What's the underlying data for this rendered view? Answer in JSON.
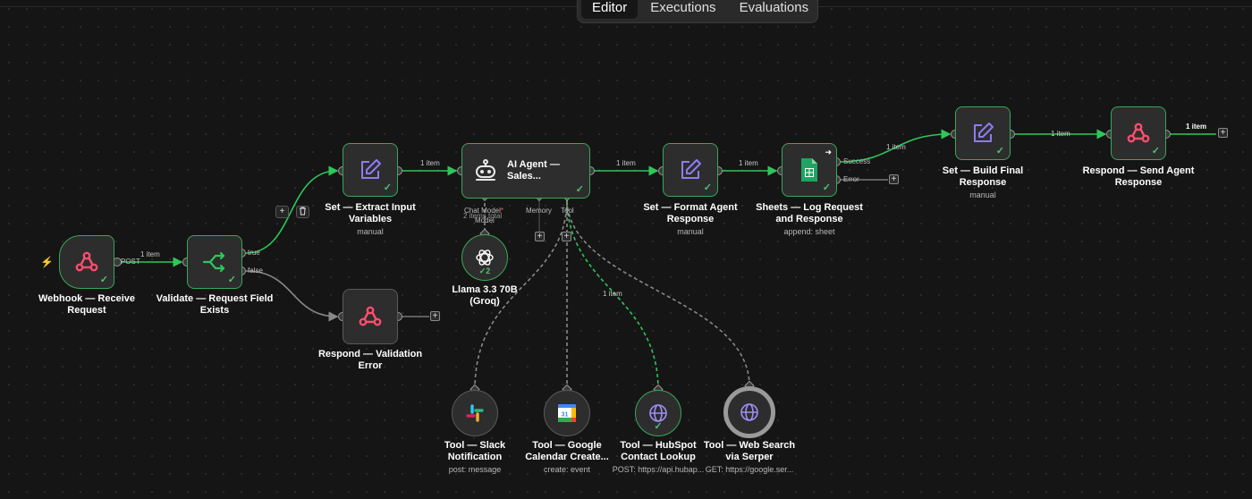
{
  "tabs": [
    {
      "label": "Editor",
      "active": true
    },
    {
      "label": "Executions",
      "active": false
    },
    {
      "label": "Evaluations",
      "active": false
    }
  ],
  "nodes": {
    "webhook": {
      "label1": "Webhook — Receive",
      "label2": "Request"
    },
    "validate": {
      "label1": "Validate — Request Field",
      "label2": "Exists"
    },
    "extract": {
      "label1": "Set — Extract Input",
      "label2": "Variables",
      "sub": "manual"
    },
    "respond_validation": {
      "label1": "Respond — Validation",
      "label2": "Error"
    },
    "agent": {
      "title1": "AI Agent —",
      "title2": "Sales..."
    },
    "format": {
      "label1": "Set — Format Agent",
      "label2": "Response",
      "sub": "manual"
    },
    "sheets": {
      "label1": "Sheets — Log Request",
      "label2": "and Response",
      "sub": "append: sheet"
    },
    "build_final": {
      "label1": "Set — Build Final",
      "label2": "Response",
      "sub": "manual"
    },
    "respond_send": {
      "label1": "Respond — Send Agent",
      "label2": "Response"
    },
    "llama": {
      "label1": "Llama 3.3 70B",
      "label2": "(Groq)",
      "badge": "2"
    },
    "slack": {
      "label1": "Tool — Slack",
      "label2": "Notification",
      "sub": "post: message"
    },
    "gcal": {
      "label1": "Tool — Google",
      "label2": "Calendar Create...",
      "sub": "create: event",
      "icon_text": "31"
    },
    "hubspot": {
      "label1": "Tool — HubSpot",
      "label2": "Contact Lookup",
      "sub": "POST: https://api.hubap..."
    },
    "serper": {
      "label1": "Tool — Web Search",
      "label2": "via Serper",
      "sub": "GET: https://google.ser..."
    }
  },
  "connectors": {
    "post": "POST",
    "true": "true",
    "false": "false",
    "success": "Success",
    "error": "Error",
    "chat_model": "Chat Model",
    "chat_model_required": "*",
    "chat_model_overlap": "2 items total",
    "model": "Model",
    "memory": "Memory",
    "tool": "Tool"
  },
  "edge_labels": {
    "webhook_validate": "1 item",
    "extract_agent": "1 item",
    "agent_format": "1 item",
    "format_sheets": "1 item",
    "sheets_build": "1 item",
    "build_respond": "1 item",
    "respond_out": "1 item",
    "hubspot_tool": "1 item"
  },
  "colors": {
    "success_border": "#37a85a",
    "edge_active": "#2ec65a",
    "edge_idle": "#777777",
    "webhook_icon": "#ff4d6d",
    "set_icon": "#8e7cf2",
    "sheets_icon": "#1fa463",
    "openai_icon": "#ffffff",
    "trigger_bolt": "#ff7a2a"
  },
  "icons": {
    "webhook": "webhook-icon",
    "validate": "if-branch-icon",
    "set": "pencil-edit-icon",
    "agent": "robot-icon",
    "sheets": "google-sheets-icon",
    "openai": "openai-icon",
    "slack": "slack-icon",
    "gcal": "google-calendar-icon",
    "globe": "globe-icon",
    "trigger": "lightning-icon"
  }
}
